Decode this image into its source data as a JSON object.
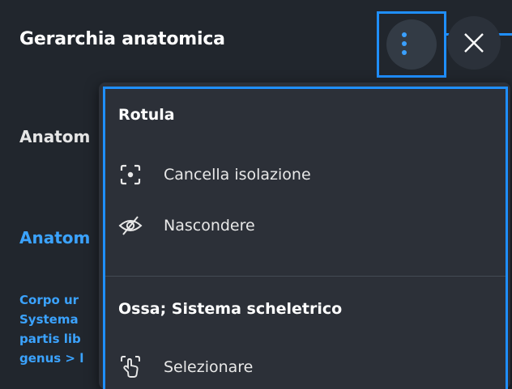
{
  "header": {
    "title": "Gerarchia anatomica"
  },
  "background": {
    "heading": "Anatom",
    "link": "Anatom",
    "path_lines": [
      "Corpo ur",
      "Systema",
      "partis lib",
      "genus > l"
    ]
  },
  "menu": {
    "sections": [
      {
        "title": "Rotula",
        "items": [
          {
            "label": "Cancella isolazione",
            "icon": "isolate-focus-icon"
          },
          {
            "label": "Nascondere",
            "icon": "eye-off-icon"
          }
        ]
      },
      {
        "title": "Ossa; Sistema scheletrico",
        "items": [
          {
            "label": "Selezionare",
            "icon": "select-hand-icon"
          }
        ]
      }
    ]
  },
  "colors": {
    "background": "#21262d",
    "menu_bg": "#2c3038",
    "accent": "#3aa0ff",
    "highlight": "#1f8fff"
  }
}
